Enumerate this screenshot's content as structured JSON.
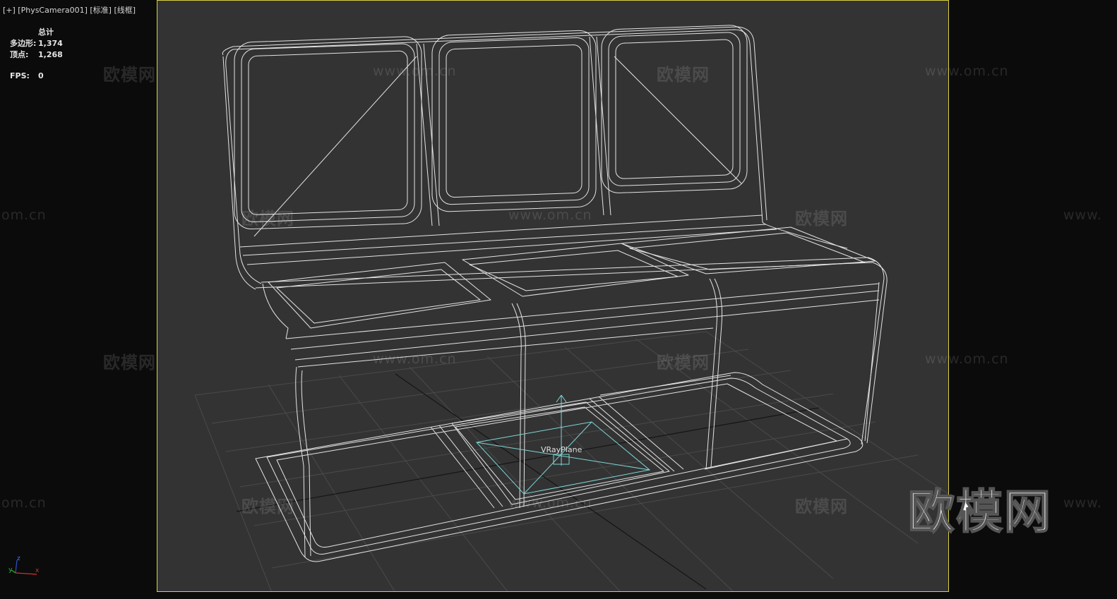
{
  "viewport": {
    "label": "[+] [PhysCamera001] [标准] [线框]"
  },
  "stats": {
    "title": "总计",
    "polygons_label": "多边形:",
    "polygons_value": "1,374",
    "vertices_label": "顶点:",
    "vertices_value": "1,268",
    "fps_label": "FPS:",
    "fps_value": "0"
  },
  "scene": {
    "object_label": "VRayPlane",
    "gizmo_axes": {
      "x": "x",
      "y": "y",
      "z": "z"
    }
  },
  "watermarks": {
    "brand": "欧模网",
    "url": "www.om.cn",
    "url_short": "om.cn",
    "url_cut": "www.",
    "logo": "欧模网"
  },
  "colors": {
    "viewport_bg": "#333333",
    "viewport_border": "#d8d040",
    "wireframe": "#e8e8e8",
    "helper": "#7fd6d6"
  }
}
